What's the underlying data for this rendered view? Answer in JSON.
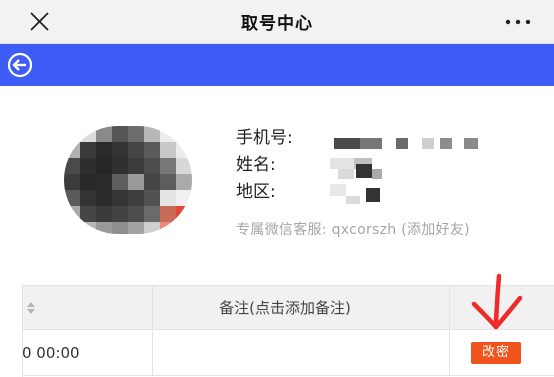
{
  "header": {
    "title": "取号中心"
  },
  "profile": {
    "phone_label": "手机号:",
    "name_label": "姓名:",
    "region_label": "地区:",
    "service_text": "专属微信客服: qxcorszh (添加好友)"
  },
  "table": {
    "note_header": "备注(点击添加备注)",
    "rows": [
      {
        "time": "0 00:00",
        "note": "",
        "action_label": "改密"
      }
    ]
  },
  "colors": {
    "nav_blue": "#3d5df6",
    "action_orange": "#f0531c",
    "annotation_red": "#ee2a2a"
  },
  "icons": [
    "close-icon",
    "more-icon",
    "back-arrow-icon",
    "sort-icon",
    "red-arrow-annotation"
  ]
}
